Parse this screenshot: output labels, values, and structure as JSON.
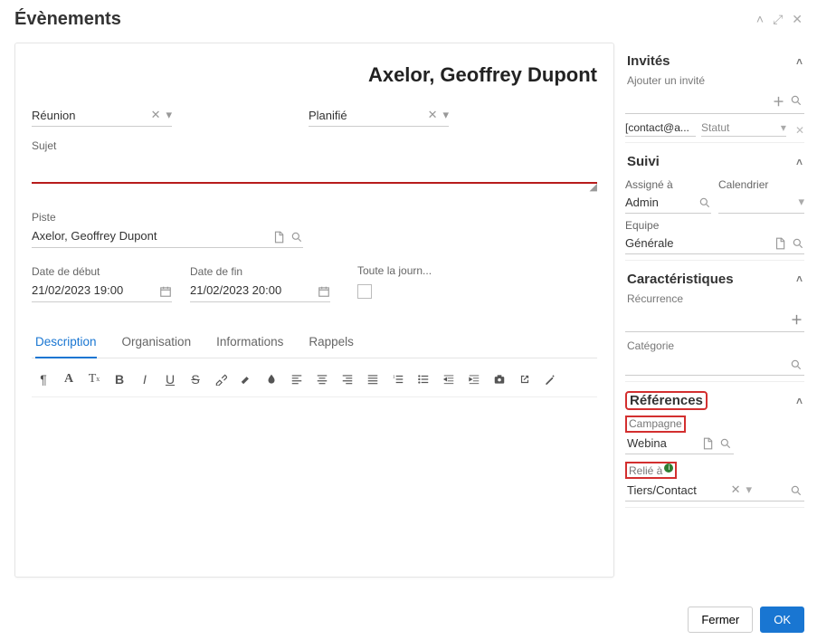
{
  "modal": {
    "title": "Évènements"
  },
  "heading": "Axelor, Geoffrey Dupont",
  "type": {
    "value": "Réunion"
  },
  "status": {
    "value": "Planifié"
  },
  "subject": {
    "label": "Sujet",
    "value": ""
  },
  "piste": {
    "label": "Piste",
    "value": "Axelor, Geoffrey Dupont"
  },
  "start": {
    "label": "Date de début",
    "value": "21/02/2023 19:00"
  },
  "end": {
    "label": "Date de fin",
    "value": "21/02/2023 20:00"
  },
  "allday": {
    "label": "Toute la journ..."
  },
  "tabs": [
    "Description",
    "Organisation",
    "Informations",
    "Rappels"
  ],
  "active_tab": 0,
  "guests": {
    "title": "Invités",
    "add_label": "Ajouter un invité",
    "items": [
      {
        "email": "[contact@a...",
        "status": "Statut"
      }
    ]
  },
  "suivi": {
    "title": "Suivi",
    "assigned_label": "Assigné à",
    "assigned_value": "Admin",
    "calendar_label": "Calendrier",
    "team_label": "Equipe",
    "team_value": "Générale"
  },
  "caract": {
    "title": "Caractéristiques",
    "recurrence_label": "Récurrence",
    "category_label": "Catégorie"
  },
  "refs": {
    "title": "Références",
    "campaign_label": "Campagne",
    "campaign_value": "Webina",
    "linked_label": "Relié à",
    "linked_value": "Tiers/Contact"
  },
  "footer": {
    "close": "Fermer",
    "ok": "OK"
  }
}
